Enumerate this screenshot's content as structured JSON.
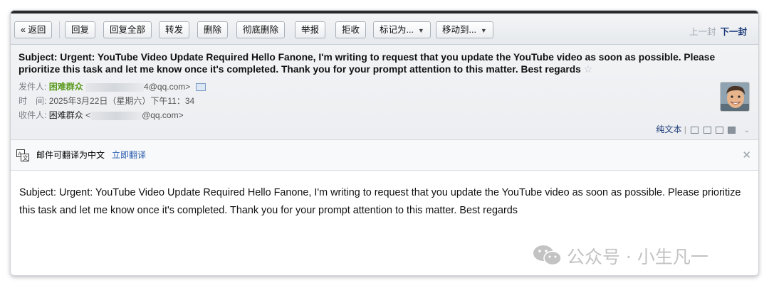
{
  "toolbar": {
    "back": "« 返回",
    "reply": "回复",
    "reply_all": "回复全部",
    "forward": "转发",
    "delete": "删除",
    "delete_perm": "彻底删除",
    "report": "举报",
    "reject": "拒收",
    "mark_as": "标记为...",
    "move_to": "移动到...",
    "prev": "上一封",
    "next": "下一封"
  },
  "mail": {
    "subject": "Subject: Urgent: YouTube Video Update Required Hello Fanone, I'm writing to request that you update the YouTube video as soon as possible. Please prioritize this task and let me know once it's completed. Thank you for your prompt attention to this matter. Best regards",
    "from_label": "发件人:",
    "from_name": "困难群众",
    "from_addr_suffix": "4@qq.com>",
    "time_label": "时　间:",
    "time_value": "2025年3月22日（星期六）下午11：34",
    "to_label": "收件人:",
    "to_name": "困难群众",
    "to_addr_prefix": "<",
    "to_addr_suffix": "@qq.com>",
    "plain_text": "纯文本",
    "body": "Subject: Urgent: YouTube Video Update Required Hello Fanone, I'm writing to request that you update the YouTube video as soon as possible. Please prioritize this task and let me know once it's completed. Thank you for your prompt attention to this matter. Best regards"
  },
  "translate": {
    "notice": "邮件可翻译为中文",
    "action": "立即翻译"
  },
  "watermark": {
    "text": "公众号 · 小生凡一"
  },
  "colors": {
    "link": "#2a5db0",
    "sender_green": "#5a9a1f",
    "toolbar_bg": "#e6e9ed"
  }
}
